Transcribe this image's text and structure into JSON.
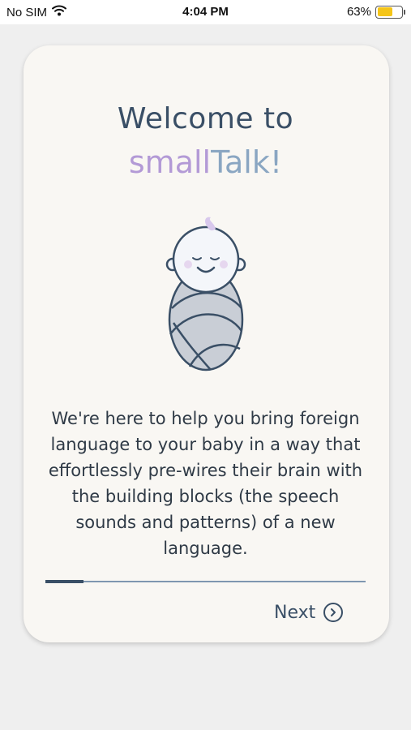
{
  "status_bar": {
    "carrier": "No SIM",
    "time": "4:04 PM",
    "battery_percent": "63%",
    "battery_level": 0.63
  },
  "welcome": {
    "title_line1": "Welcome to",
    "brand_part1": "small",
    "brand_part2": "Talk!",
    "description": "We're here to help you bring foreign language to your baby in a way that effortlessly pre-wires their brain with the building blocks (the speech sounds and patterns) of a new language."
  },
  "onboarding": {
    "progress": 0.12,
    "next_label": "Next"
  },
  "colors": {
    "title": "#3a4f66",
    "brand_small": "#b39ad6",
    "brand_talk": "#8aa6c2",
    "card_bg": "#f9f7f3",
    "battery": "#f5c518"
  },
  "icons": [
    "wifi-icon",
    "battery-icon",
    "baby-illustration",
    "chevron-right-circle-icon"
  ]
}
